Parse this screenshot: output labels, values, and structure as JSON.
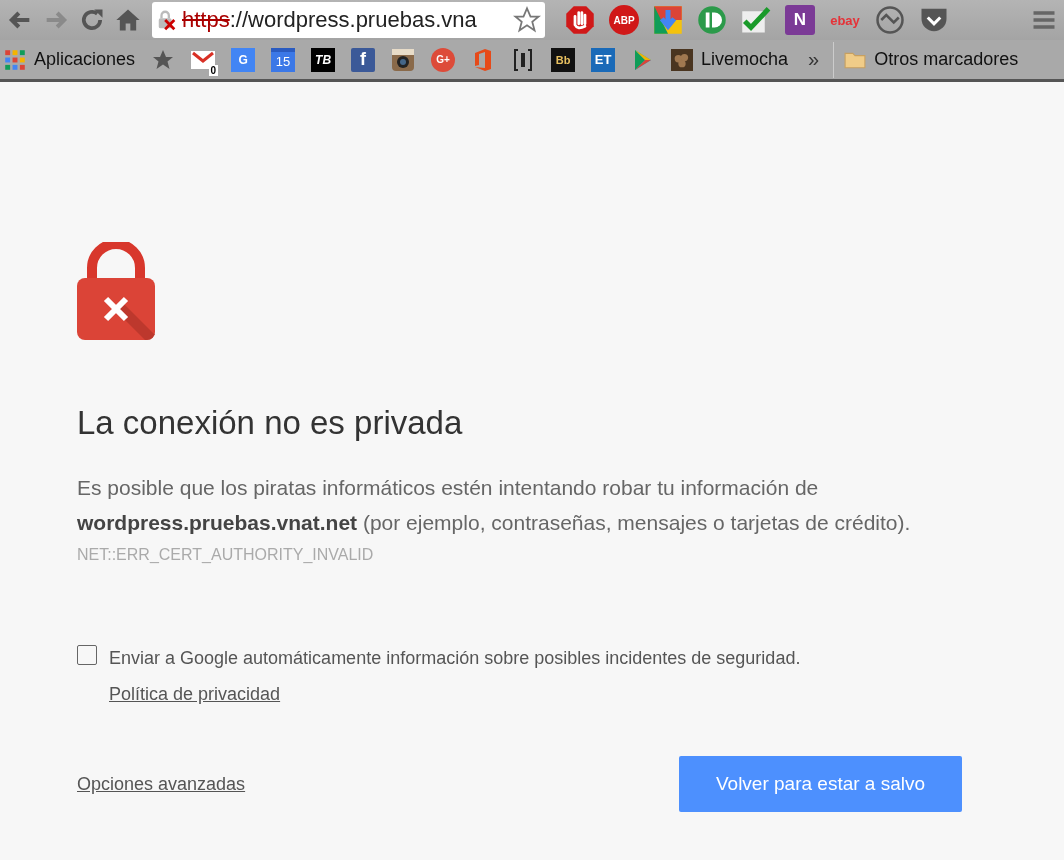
{
  "toolbar": {
    "url_scheme": "https",
    "url_rest": "://wordpress.pruebas.vna",
    "extensions": [
      {
        "kind": "stop"
      },
      {
        "kind": "abp",
        "glyph": "ABP"
      },
      {
        "kind": "download"
      },
      {
        "kind": "pushbullet"
      },
      {
        "kind": "check"
      },
      {
        "kind": "onenote",
        "glyph": "N"
      },
      {
        "kind": "ebay",
        "glyph": "ebay"
      },
      {
        "kind": "sync"
      },
      {
        "kind": "pocket"
      }
    ]
  },
  "bookmarks": {
    "items": [
      {
        "kind": "apps",
        "label": "Aplicaciones"
      },
      {
        "kind": "star"
      },
      {
        "kind": "gmail",
        "glyph": "0"
      },
      {
        "kind": "translate",
        "glyph": "G"
      },
      {
        "kind": "calendar",
        "glyph": "15"
      },
      {
        "kind": "tb",
        "glyph": "TB"
      },
      {
        "kind": "facebook",
        "glyph": "f"
      },
      {
        "kind": "camera"
      },
      {
        "kind": "gplus",
        "glyph": "G+"
      },
      {
        "kind": "office"
      },
      {
        "kind": "bracket"
      },
      {
        "kind": "bb",
        "glyph": "Bb"
      },
      {
        "kind": "et",
        "glyph": "ET"
      },
      {
        "kind": "play"
      },
      {
        "kind": "livemocha",
        "label": "Livemocha"
      }
    ],
    "overflow": "»",
    "other": "Otros marcadores"
  },
  "page": {
    "heading": "La conexión no es privada",
    "message": "Es posible que los piratas informáticos estén intentando robar tu información de **wordpress.pruebas.vnat.net** (por ejemplo, contraseñas, mensajes o tarjetas de crédito).",
    "error_code": "NET::ERR_CERT_AUTHORITY_INVALID",
    "report": {
      "checked": false,
      "text": "Enviar a Google automáticamente información sobre posibles incidentes de seguridad.",
      "link": "Política de privacidad"
    },
    "advanced_link": "Opciones avanzadas",
    "primary_button": "Volver para estar a salvo"
  }
}
